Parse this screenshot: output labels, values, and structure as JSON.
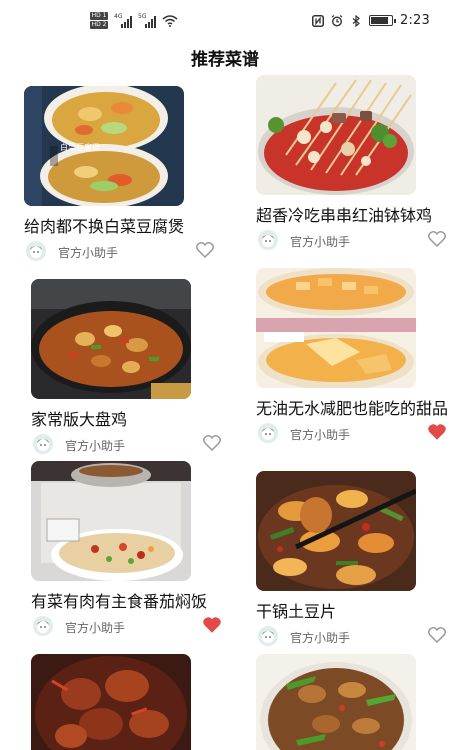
{
  "status_bar": {
    "sim1": "HD 1",
    "sim2": "HD 2",
    "net1": "4G",
    "net2": "5G",
    "time": "2:23",
    "battery_level": 0.9
  },
  "header": {
    "title": "推荐菜谱"
  },
  "colors": {
    "liked": "#e24a4a",
    "unliked": "#9a9a9a"
  },
  "recipes": [
    {
      "title": "给肉都不换白菜豆腐煲",
      "author": "官方小助手",
      "liked": false,
      "image_caption": "白菜豆腐煲"
    },
    {
      "title": "超香冷吃串串红油钵钵鸡",
      "author": "官方小助手",
      "liked": false
    },
    {
      "title": "家常版大盘鸡",
      "author": "官方小助手",
      "liked": false
    },
    {
      "title": "无油无水减肥也能吃的甜品",
      "author": "官方小助手",
      "liked": true
    },
    {
      "title": "有菜有肉有主食番茄焖饭",
      "author": "官方小助手",
      "liked": true
    },
    {
      "title": "干锅土豆片",
      "author": "官方小助手",
      "liked": false
    },
    {
      "title": "",
      "author": "",
      "liked": false
    },
    {
      "title": "",
      "author": "",
      "liked": false
    }
  ]
}
